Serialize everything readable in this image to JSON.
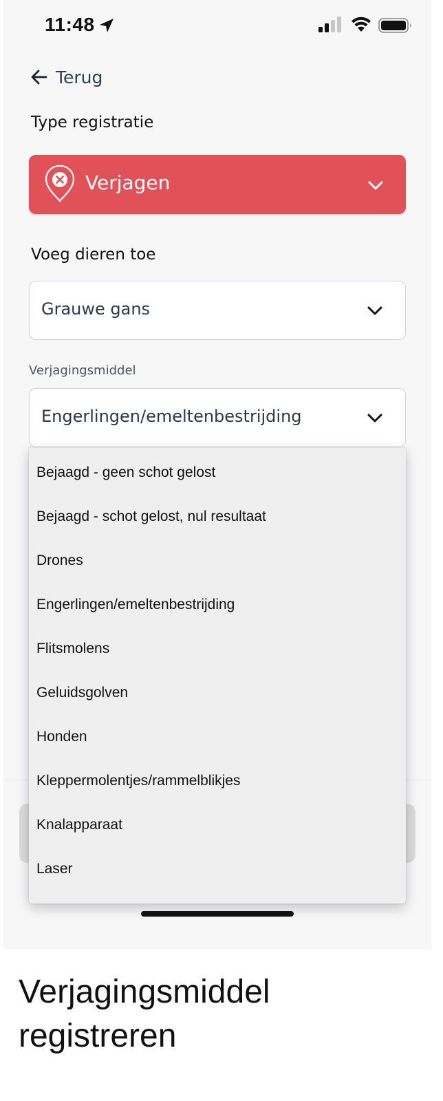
{
  "status_bar": {
    "time": "11:48",
    "icons": [
      "location-arrow-icon",
      "cell-signal-icon",
      "wifi-icon",
      "battery-icon"
    ]
  },
  "nav": {
    "back_label": "Terug",
    "back_icon": "arrow-left-icon"
  },
  "form": {
    "type_label": "Type registratie",
    "type_value": "Verjagen",
    "type_color": "#e05257",
    "type_icon": "location-pin-x-icon",
    "animals_label": "Voeg dieren toe",
    "animals_value": "Grauwe gans",
    "means_label": "Verjagingsmiddel",
    "means_value": "Engerlingen/emeltenbestrijding"
  },
  "dropdown": {
    "options": [
      "Bejaagd - geen schot gelost",
      "Bejaagd - schot gelost, nul resultaat",
      "Drones",
      "Engerlingen/emeltenbestrijding",
      "Flitsmolens",
      "Geluidsgolven",
      "Honden",
      "Kleppermolentjes/rammelblikjes",
      "Knalapparaat",
      "Laser"
    ]
  },
  "caption": {
    "line1": "Verjagingsmiddel",
    "line2": "registreren"
  }
}
